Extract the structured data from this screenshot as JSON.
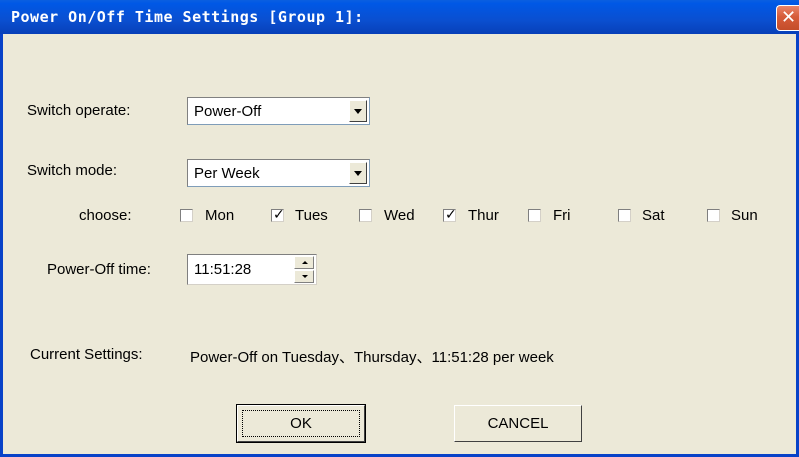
{
  "window": {
    "title": "Power On/Off Time Settings [Group 1]:",
    "close_glyph": "✕"
  },
  "switch_operate": {
    "label": "Switch operate:",
    "value": "Power-Off"
  },
  "switch_mode": {
    "label": "Switch  mode:",
    "value": "Per Week"
  },
  "choose": {
    "label": "choose:",
    "days": [
      {
        "label": "Mon",
        "checked": false
      },
      {
        "label": "Tues",
        "checked": true
      },
      {
        "label": "Wed",
        "checked": false
      },
      {
        "label": "Thur",
        "checked": true
      },
      {
        "label": "Fri",
        "checked": false
      },
      {
        "label": "Sat",
        "checked": false
      },
      {
        "label": "Sun",
        "checked": false
      }
    ]
  },
  "time": {
    "label": "Power-Off time:",
    "value": "11:51:28"
  },
  "current": {
    "label": "Current Settings:",
    "value": "Power-Off on Tuesday、Thursday、11:51:28 per week"
  },
  "buttons": {
    "ok": "OK",
    "cancel": "CANCEL"
  },
  "colors": {
    "titlebar": "#0a4fd0",
    "dialog_bg": "#ece9d8",
    "close": "#d65c3a"
  }
}
